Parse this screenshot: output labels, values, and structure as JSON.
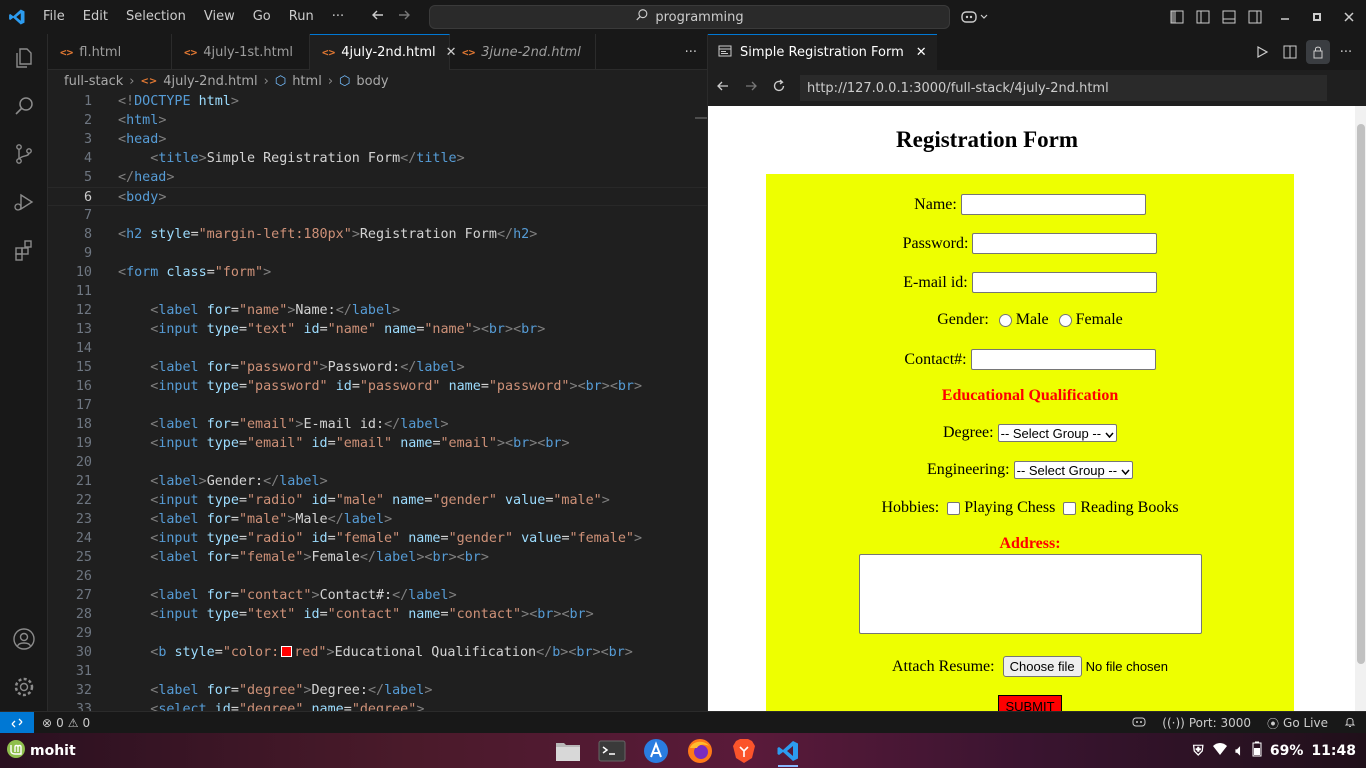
{
  "menu": [
    "File",
    "Edit",
    "Selection",
    "View",
    "Go",
    "Run",
    "···"
  ],
  "search": {
    "text": "programming"
  },
  "editor": {
    "tabs": [
      {
        "label": "fl.html",
        "active": false,
        "italic": false
      },
      {
        "label": "4july-1st.html",
        "active": false,
        "italic": false
      },
      {
        "label": "4july-2nd.html",
        "active": true,
        "italic": false
      },
      {
        "label": "3june-2nd.html",
        "active": false,
        "italic": true
      }
    ],
    "tabs_more": "···",
    "breadcrumb": [
      "full-stack",
      "4july-2nd.html",
      "html",
      "body"
    ],
    "current_line": 6
  },
  "code_lines": [
    [
      [
        "t-br",
        "<!"
      ],
      [
        "t-tag",
        "DOCTYPE"
      ],
      [
        "t-txt",
        " "
      ],
      [
        "t-attr",
        "html"
      ],
      [
        "t-br",
        ">"
      ]
    ],
    [
      [
        "t-br",
        "<"
      ],
      [
        "t-tag",
        "html"
      ],
      [
        "t-br",
        ">"
      ]
    ],
    [
      [
        "t-br",
        "<"
      ],
      [
        "t-tag",
        "head"
      ],
      [
        "t-br",
        ">"
      ]
    ],
    [
      [
        "t-txt",
        "    "
      ],
      [
        "t-br",
        "<"
      ],
      [
        "t-tag",
        "title"
      ],
      [
        "t-br",
        ">"
      ],
      [
        "t-txt",
        "Simple Registration Form"
      ],
      [
        "t-br",
        "</"
      ],
      [
        "t-tag",
        "title"
      ],
      [
        "t-br",
        ">"
      ]
    ],
    [
      [
        "t-br",
        "</"
      ],
      [
        "t-tag",
        "head"
      ],
      [
        "t-br",
        ">"
      ]
    ],
    [
      [
        "t-br",
        "<"
      ],
      [
        "t-tag",
        "body"
      ],
      [
        "t-br",
        ">"
      ]
    ],
    [],
    [
      [
        "t-br",
        "<"
      ],
      [
        "t-tag",
        "h2"
      ],
      [
        "t-txt",
        " "
      ],
      [
        "t-attr",
        "style"
      ],
      [
        "t-txt",
        "="
      ],
      [
        "t-str",
        "\"margin-left:180px\""
      ],
      [
        "t-br",
        ">"
      ],
      [
        "t-txt",
        "Registration Form"
      ],
      [
        "t-br",
        "</"
      ],
      [
        "t-tag",
        "h2"
      ],
      [
        "t-br",
        ">"
      ]
    ],
    [],
    [
      [
        "t-br",
        "<"
      ],
      [
        "t-tag",
        "form"
      ],
      [
        "t-txt",
        " "
      ],
      [
        "t-attr",
        "class"
      ],
      [
        "t-txt",
        "="
      ],
      [
        "t-str",
        "\"form\""
      ],
      [
        "t-br",
        ">"
      ]
    ],
    [],
    [
      [
        "t-txt",
        "    "
      ],
      [
        "t-br",
        "<"
      ],
      [
        "t-tag",
        "label"
      ],
      [
        "t-txt",
        " "
      ],
      [
        "t-attr",
        "for"
      ],
      [
        "t-txt",
        "="
      ],
      [
        "t-str",
        "\"name\""
      ],
      [
        "t-br",
        ">"
      ],
      [
        "t-txt",
        "Name:"
      ],
      [
        "t-br",
        "</"
      ],
      [
        "t-tag",
        "label"
      ],
      [
        "t-br",
        ">"
      ]
    ],
    [
      [
        "t-txt",
        "    "
      ],
      [
        "t-br",
        "<"
      ],
      [
        "t-tag",
        "input"
      ],
      [
        "t-txt",
        " "
      ],
      [
        "t-attr",
        "type"
      ],
      [
        "t-txt",
        "="
      ],
      [
        "t-str",
        "\"text\""
      ],
      [
        "t-txt",
        " "
      ],
      [
        "t-attr",
        "id"
      ],
      [
        "t-txt",
        "="
      ],
      [
        "t-str",
        "\"name\""
      ],
      [
        "t-txt",
        " "
      ],
      [
        "t-attr",
        "name"
      ],
      [
        "t-txt",
        "="
      ],
      [
        "t-str",
        "\"name\""
      ],
      [
        "t-br",
        ">"
      ],
      [
        "t-br",
        "<"
      ],
      [
        "t-tag",
        "br"
      ],
      [
        "t-br",
        ">"
      ],
      [
        "t-br",
        "<"
      ],
      [
        "t-tag",
        "br"
      ],
      [
        "t-br",
        ">"
      ]
    ],
    [],
    [
      [
        "t-txt",
        "    "
      ],
      [
        "t-br",
        "<"
      ],
      [
        "t-tag",
        "label"
      ],
      [
        "t-txt",
        " "
      ],
      [
        "t-attr",
        "for"
      ],
      [
        "t-txt",
        "="
      ],
      [
        "t-str",
        "\"password\""
      ],
      [
        "t-br",
        ">"
      ],
      [
        "t-txt",
        "Password:"
      ],
      [
        "t-br",
        "</"
      ],
      [
        "t-tag",
        "label"
      ],
      [
        "t-br",
        ">"
      ]
    ],
    [
      [
        "t-txt",
        "    "
      ],
      [
        "t-br",
        "<"
      ],
      [
        "t-tag",
        "input"
      ],
      [
        "t-txt",
        " "
      ],
      [
        "t-attr",
        "type"
      ],
      [
        "t-txt",
        "="
      ],
      [
        "t-str",
        "\"password\""
      ],
      [
        "t-txt",
        " "
      ],
      [
        "t-attr",
        "id"
      ],
      [
        "t-txt",
        "="
      ],
      [
        "t-str",
        "\"password\""
      ],
      [
        "t-txt",
        " "
      ],
      [
        "t-attr",
        "name"
      ],
      [
        "t-txt",
        "="
      ],
      [
        "t-str",
        "\"password\""
      ],
      [
        "t-br",
        ">"
      ],
      [
        "t-br",
        "<"
      ],
      [
        "t-tag",
        "br"
      ],
      [
        "t-br",
        ">"
      ],
      [
        "t-br",
        "<"
      ],
      [
        "t-tag",
        "br"
      ],
      [
        "t-br",
        ">"
      ]
    ],
    [],
    [
      [
        "t-txt",
        "    "
      ],
      [
        "t-br",
        "<"
      ],
      [
        "t-tag",
        "label"
      ],
      [
        "t-txt",
        " "
      ],
      [
        "t-attr",
        "for"
      ],
      [
        "t-txt",
        "="
      ],
      [
        "t-str",
        "\"email\""
      ],
      [
        "t-br",
        ">"
      ],
      [
        "t-txt",
        "E-mail id:"
      ],
      [
        "t-br",
        "</"
      ],
      [
        "t-tag",
        "label"
      ],
      [
        "t-br",
        ">"
      ]
    ],
    [
      [
        "t-txt",
        "    "
      ],
      [
        "t-br",
        "<"
      ],
      [
        "t-tag",
        "input"
      ],
      [
        "t-txt",
        " "
      ],
      [
        "t-attr",
        "type"
      ],
      [
        "t-txt",
        "="
      ],
      [
        "t-str",
        "\"email\""
      ],
      [
        "t-txt",
        " "
      ],
      [
        "t-attr",
        "id"
      ],
      [
        "t-txt",
        "="
      ],
      [
        "t-str",
        "\"email\""
      ],
      [
        "t-txt",
        " "
      ],
      [
        "t-attr",
        "name"
      ],
      [
        "t-txt",
        "="
      ],
      [
        "t-str",
        "\"email\""
      ],
      [
        "t-br",
        ">"
      ],
      [
        "t-br",
        "<"
      ],
      [
        "t-tag",
        "br"
      ],
      [
        "t-br",
        ">"
      ],
      [
        "t-br",
        "<"
      ],
      [
        "t-tag",
        "br"
      ],
      [
        "t-br",
        ">"
      ]
    ],
    [],
    [
      [
        "t-txt",
        "    "
      ],
      [
        "t-br",
        "<"
      ],
      [
        "t-tag",
        "label"
      ],
      [
        "t-br",
        ">"
      ],
      [
        "t-txt",
        "Gender:"
      ],
      [
        "t-br",
        "</"
      ],
      [
        "t-tag",
        "label"
      ],
      [
        "t-br",
        ">"
      ]
    ],
    [
      [
        "t-txt",
        "    "
      ],
      [
        "t-br",
        "<"
      ],
      [
        "t-tag",
        "input"
      ],
      [
        "t-txt",
        " "
      ],
      [
        "t-attr",
        "type"
      ],
      [
        "t-txt",
        "="
      ],
      [
        "t-str",
        "\"radio\""
      ],
      [
        "t-txt",
        " "
      ],
      [
        "t-attr",
        "id"
      ],
      [
        "t-txt",
        "="
      ],
      [
        "t-str",
        "\"male\""
      ],
      [
        "t-txt",
        " "
      ],
      [
        "t-attr",
        "name"
      ],
      [
        "t-txt",
        "="
      ],
      [
        "t-str",
        "\"gender\""
      ],
      [
        "t-txt",
        " "
      ],
      [
        "t-attr",
        "value"
      ],
      [
        "t-txt",
        "="
      ],
      [
        "t-str",
        "\"male\""
      ],
      [
        "t-br",
        ">"
      ]
    ],
    [
      [
        "t-txt",
        "    "
      ],
      [
        "t-br",
        "<"
      ],
      [
        "t-tag",
        "label"
      ],
      [
        "t-txt",
        " "
      ],
      [
        "t-attr",
        "for"
      ],
      [
        "t-txt",
        "="
      ],
      [
        "t-str",
        "\"male\""
      ],
      [
        "t-br",
        ">"
      ],
      [
        "t-txt",
        "Male"
      ],
      [
        "t-br",
        "</"
      ],
      [
        "t-tag",
        "label"
      ],
      [
        "t-br",
        ">"
      ]
    ],
    [
      [
        "t-txt",
        "    "
      ],
      [
        "t-br",
        "<"
      ],
      [
        "t-tag",
        "input"
      ],
      [
        "t-txt",
        " "
      ],
      [
        "t-attr",
        "type"
      ],
      [
        "t-txt",
        "="
      ],
      [
        "t-str",
        "\"radio\""
      ],
      [
        "t-txt",
        " "
      ],
      [
        "t-attr",
        "id"
      ],
      [
        "t-txt",
        "="
      ],
      [
        "t-str",
        "\"female\""
      ],
      [
        "t-txt",
        " "
      ],
      [
        "t-attr",
        "name"
      ],
      [
        "t-txt",
        "="
      ],
      [
        "t-str",
        "\"gender\""
      ],
      [
        "t-txt",
        " "
      ],
      [
        "t-attr",
        "value"
      ],
      [
        "t-txt",
        "="
      ],
      [
        "t-str",
        "\"female\""
      ],
      [
        "t-br",
        ">"
      ]
    ],
    [
      [
        "t-txt",
        "    "
      ],
      [
        "t-br",
        "<"
      ],
      [
        "t-tag",
        "label"
      ],
      [
        "t-txt",
        " "
      ],
      [
        "t-attr",
        "for"
      ],
      [
        "t-txt",
        "="
      ],
      [
        "t-str",
        "\"female\""
      ],
      [
        "t-br",
        ">"
      ],
      [
        "t-txt",
        "Female"
      ],
      [
        "t-br",
        "</"
      ],
      [
        "t-tag",
        "label"
      ],
      [
        "t-br",
        ">"
      ],
      [
        "t-br",
        "<"
      ],
      [
        "t-tag",
        "br"
      ],
      [
        "t-br",
        ">"
      ],
      [
        "t-br",
        "<"
      ],
      [
        "t-tag",
        "br"
      ],
      [
        "t-br",
        ">"
      ]
    ],
    [],
    [
      [
        "t-txt",
        "    "
      ],
      [
        "t-br",
        "<"
      ],
      [
        "t-tag",
        "label"
      ],
      [
        "t-txt",
        " "
      ],
      [
        "t-attr",
        "for"
      ],
      [
        "t-txt",
        "="
      ],
      [
        "t-str",
        "\"contact\""
      ],
      [
        "t-br",
        ">"
      ],
      [
        "t-txt",
        "Contact#:"
      ],
      [
        "t-br",
        "</"
      ],
      [
        "t-tag",
        "label"
      ],
      [
        "t-br",
        ">"
      ]
    ],
    [
      [
        "t-txt",
        "    "
      ],
      [
        "t-br",
        "<"
      ],
      [
        "t-tag",
        "input"
      ],
      [
        "t-txt",
        " "
      ],
      [
        "t-attr",
        "type"
      ],
      [
        "t-txt",
        "="
      ],
      [
        "t-str",
        "\"text\""
      ],
      [
        "t-txt",
        " "
      ],
      [
        "t-attr",
        "id"
      ],
      [
        "t-txt",
        "="
      ],
      [
        "t-str",
        "\"contact\""
      ],
      [
        "t-txt",
        " "
      ],
      [
        "t-attr",
        "name"
      ],
      [
        "t-txt",
        "="
      ],
      [
        "t-str",
        "\"contact\""
      ],
      [
        "t-br",
        ">"
      ],
      [
        "t-br",
        "<"
      ],
      [
        "t-tag",
        "br"
      ],
      [
        "t-br",
        ">"
      ],
      [
        "t-br",
        "<"
      ],
      [
        "t-tag",
        "br"
      ],
      [
        "t-br",
        ">"
      ]
    ],
    [],
    [
      [
        "t-txt",
        "    "
      ],
      [
        "t-br",
        "<"
      ],
      [
        "t-tag",
        "b"
      ],
      [
        "t-txt",
        " "
      ],
      [
        "t-attr",
        "style"
      ],
      [
        "t-txt",
        "="
      ],
      [
        "t-str",
        "\"color:"
      ],
      [
        "swatch",
        ""
      ],
      [
        "t-str",
        "red\""
      ],
      [
        "t-br",
        ">"
      ],
      [
        "t-txt",
        "Educational Qualification"
      ],
      [
        "t-br",
        "</"
      ],
      [
        "t-tag",
        "b"
      ],
      [
        "t-br",
        ">"
      ],
      [
        "t-br",
        "<"
      ],
      [
        "t-tag",
        "br"
      ],
      [
        "t-br",
        ">"
      ],
      [
        "t-br",
        "<"
      ],
      [
        "t-tag",
        "br"
      ],
      [
        "t-br",
        ">"
      ]
    ],
    [],
    [
      [
        "t-txt",
        "    "
      ],
      [
        "t-br",
        "<"
      ],
      [
        "t-tag",
        "label"
      ],
      [
        "t-txt",
        " "
      ],
      [
        "t-attr",
        "for"
      ],
      [
        "t-txt",
        "="
      ],
      [
        "t-str",
        "\"degree\""
      ],
      [
        "t-br",
        ">"
      ],
      [
        "t-txt",
        "Degree:"
      ],
      [
        "t-br",
        "</"
      ],
      [
        "t-tag",
        "label"
      ],
      [
        "t-br",
        ">"
      ]
    ],
    [
      [
        "t-txt",
        "    "
      ],
      [
        "t-br",
        "<"
      ],
      [
        "t-tag",
        "select"
      ],
      [
        "t-txt",
        " "
      ],
      [
        "t-attr",
        "id"
      ],
      [
        "t-txt",
        "="
      ],
      [
        "t-str",
        "\"degree\""
      ],
      [
        "t-txt",
        " "
      ],
      [
        "t-attr",
        "name"
      ],
      [
        "t-txt",
        "="
      ],
      [
        "t-str",
        "\"degree\""
      ],
      [
        "t-br",
        ">"
      ]
    ]
  ],
  "browser": {
    "tab_title": "Simple Registration Form",
    "url": "http://127.0.0.1:3000/full-stack/4july-2nd.html",
    "page": {
      "heading": "Registration Form",
      "name_label": "Name:",
      "password_label": "Password:",
      "email_label": "E-mail id:",
      "gender_label": "Gender:",
      "male_label": "Male",
      "female_label": "Female",
      "contact_label": "Contact#:",
      "edu_heading": "Educational Qualification",
      "degree_label": "Degree:",
      "degree_value": "-- Select Group --",
      "engineering_label": "Engineering:",
      "engineering_value": "-- Select Group --",
      "hobbies_label": "Hobbies:",
      "hobby1": "Playing Chess",
      "hobby2": "Reading Books",
      "address_label": "Address:",
      "resume_label": "Attach Resume:",
      "file_button": "Choose file",
      "file_status": "No file chosen",
      "submit_label": "SUBMIT"
    }
  },
  "statusbar": {
    "errors": "0",
    "warnings": "0",
    "port": "Port: 3000",
    "golive": "Go Live"
  },
  "taskbar": {
    "user": "mohit",
    "battery": "69%",
    "time": "11:48"
  },
  "colors": {
    "form_bg": "#eeff00",
    "accent": "#0078d4",
    "red": "#ff0000"
  }
}
